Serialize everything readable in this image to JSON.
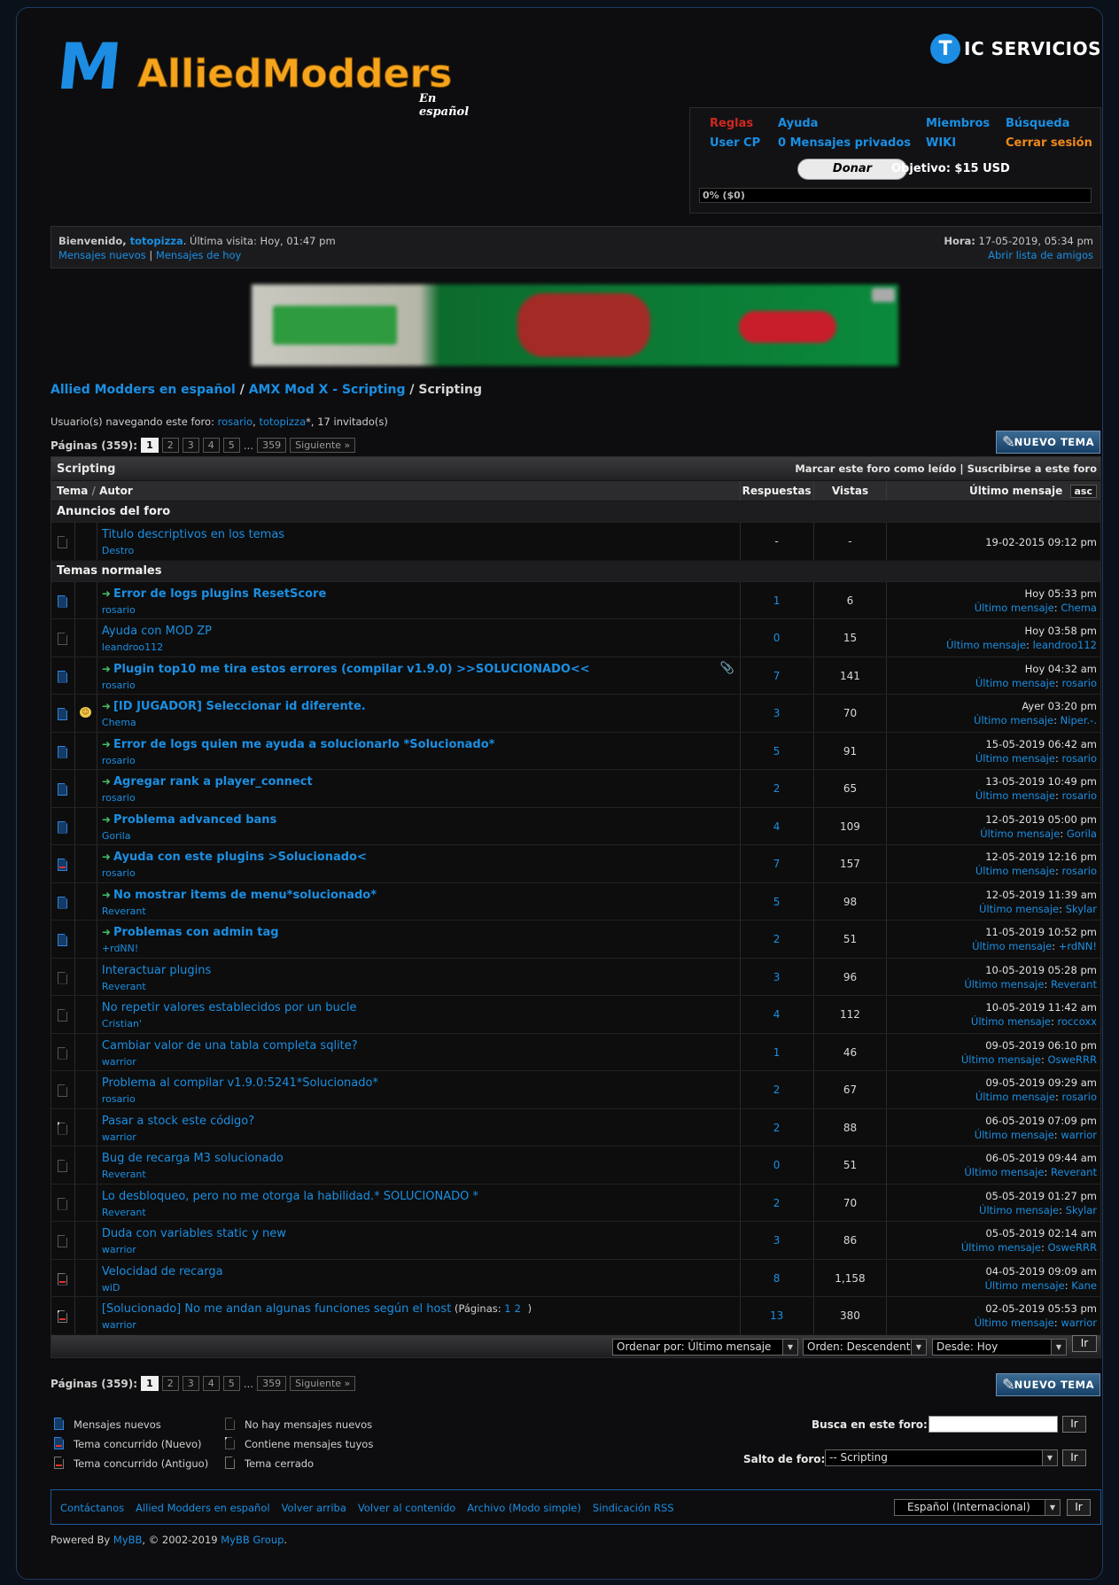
{
  "header": {
    "logo_mark": "M",
    "logo_word": "AlliedModders",
    "logo_sub": "En español",
    "tic_letter": "T",
    "tic_text": "IC SERVICIOS"
  },
  "userbox": {
    "links_row1": [
      "Reglas",
      "Ayuda",
      "Miembros",
      "Búsqueda"
    ],
    "links_row2": [
      "User CP",
      "0 Mensajes privados",
      "WIKI",
      "Cerrar sesión"
    ],
    "donate_label": "Donar",
    "goal_text": "Objetivo: $15 USD",
    "progress_text": "0% ($0)",
    "progress_fraction": 0,
    "colors": {
      "reglas": "#d0281e",
      "cerrar": "#f08a1a",
      "link": "#1a8fe3"
    }
  },
  "welcome": {
    "greeting_pre": "Bienvenido, ",
    "username": "totopizza",
    "last_visit": ". Última visita: Hoy, 01:47 pm",
    "new_posts": "Mensajes nuevos",
    "sep": "|",
    "today_posts": "Mensajes de hoy",
    "time_label": "Hora:",
    "time_value": " 17-05-2019, 05:34 pm",
    "buddy_list": "Abrir lista de amigos"
  },
  "breadcrumb": {
    "home": "Allied Modders en español",
    "sep1": " / ",
    "forum": "AMX Mod X - Scripting",
    "sep2": " / ",
    "current": "Scripting"
  },
  "browsing": {
    "label": "Usuario(s) navegando este foro: ",
    "u1": "rosario",
    "comma": ", ",
    "u2": "totopizza",
    "rest": "*, 17 invitado(s)"
  },
  "pagination": {
    "label": "Páginas (359):",
    "pages": [
      "1",
      "2",
      "3",
      "4",
      "5"
    ],
    "dots": "...",
    "last": "359",
    "next": "Siguiente »"
  },
  "new_thread_label": "NUEVO TEMA",
  "table": {
    "title": "Scripting",
    "mark_read": "Marcar este foro como leído",
    "sep": " | ",
    "subscribe": "Suscribirse a este foro",
    "col_tema": "Tema",
    "col_sep": " / ",
    "col_autor": "Autor",
    "col_replies": "Respuestas",
    "col_views": "Vistas",
    "col_last": "Último mensaje",
    "sort_dir": "asc",
    "section_announce": "Anuncios del foro",
    "section_normal": "Temas normales",
    "announcement": {
      "subject": "Titulo descriptivos en los temas",
      "author": "Destro",
      "replies": "-",
      "views": "-",
      "last": "19-02-2015 09:12 pm"
    },
    "last_post_label": "Último mensaje",
    "threads": [
      {
        "icon": "new",
        "sticky": true,
        "subject": "Error de logs plugins ResetScore",
        "author": "rosario",
        "replies": "1",
        "views": "6",
        "last_date": "Hoy 05:33 pm",
        "last_user": "Chema",
        "clip": false,
        "rowicon": false,
        "mine": false
      },
      {
        "icon": "old",
        "sticky": false,
        "subject": "Ayuda con MOD ZP",
        "author": "leandroo112",
        "replies": "0",
        "views": "15",
        "last_date": "Hoy 03:58 pm",
        "last_user": "leandroo112",
        "clip": false,
        "rowicon": false,
        "mine": false
      },
      {
        "icon": "new",
        "sticky": true,
        "subject": "Plugin top10 me tira estos errores (compilar v1.9.0) >>SOLUCIONADO<<",
        "author": "rosario",
        "replies": "7",
        "views": "141",
        "last_date": "Hoy 04:32 am",
        "last_user": "rosario",
        "clip": true,
        "rowicon": false,
        "mine": false
      },
      {
        "icon": "new",
        "sticky": true,
        "subject": "[ID JUGADOR] Seleccionar id diferente.",
        "author": "Chema",
        "replies": "3",
        "views": "70",
        "last_date": "Ayer 03:20 pm",
        "last_user": "Niper.-.",
        "clip": false,
        "rowicon": true,
        "mine": false
      },
      {
        "icon": "new",
        "sticky": true,
        "subject": "Error de logs quien me ayuda a solucionarlo *Solucionado*",
        "author": "rosario",
        "replies": "5",
        "views": "91",
        "last_date": "15-05-2019 06:42 am",
        "last_user": "rosario",
        "clip": false,
        "rowicon": false,
        "mine": false
      },
      {
        "icon": "new",
        "sticky": true,
        "subject": "Agregar rank a player_connect",
        "author": "rosario",
        "replies": "2",
        "views": "65",
        "last_date": "13-05-2019 10:49 pm",
        "last_user": "rosario",
        "clip": false,
        "rowicon": false,
        "mine": false
      },
      {
        "icon": "new",
        "sticky": true,
        "subject": "Problema advanced bans",
        "author": "Gorila",
        "replies": "4",
        "views": "109",
        "last_date": "12-05-2019 05:00 pm",
        "last_user": "Gorila",
        "clip": false,
        "rowicon": false,
        "mine": false
      },
      {
        "icon": "hot",
        "sticky": true,
        "subject": "Ayuda con este plugins >Solucionado<",
        "author": "rosario",
        "replies": "7",
        "views": "157",
        "last_date": "12-05-2019 12:16 pm",
        "last_user": "rosario",
        "clip": false,
        "rowicon": false,
        "mine": false
      },
      {
        "icon": "new",
        "sticky": true,
        "subject": "No mostrar items de menu*solucionado*",
        "author": "Reverant",
        "replies": "5",
        "views": "98",
        "last_date": "12-05-2019 11:39 am",
        "last_user": "Skylar",
        "clip": false,
        "rowicon": false,
        "mine": false
      },
      {
        "icon": "new",
        "sticky": true,
        "subject": "Problemas con admin tag",
        "author": "+rdNN!",
        "replies": "2",
        "views": "51",
        "last_date": "11-05-2019 10:52 pm",
        "last_user": "+rdNN!",
        "clip": false,
        "rowicon": false,
        "mine": false
      },
      {
        "icon": "old",
        "sticky": false,
        "subject": "Interactuar plugins",
        "author": "Reverant",
        "replies": "3",
        "views": "96",
        "last_date": "10-05-2019 05:28 pm",
        "last_user": "Reverant",
        "clip": false,
        "rowicon": false,
        "mine": false
      },
      {
        "icon": "old",
        "sticky": false,
        "subject": "No repetir valores establecidos por un bucle",
        "author": "Cristian'",
        "replies": "4",
        "views": "112",
        "last_date": "10-05-2019 11:42 am",
        "last_user": "roccoxx",
        "clip": false,
        "rowicon": false,
        "mine": false
      },
      {
        "icon": "old",
        "sticky": false,
        "subject": "Cambiar valor de una tabla completa sqlite?",
        "author": "warrior",
        "replies": "1",
        "views": "46",
        "last_date": "09-05-2019 06:10 pm",
        "last_user": "OsweRRR",
        "clip": false,
        "rowicon": false,
        "mine": false
      },
      {
        "icon": "old",
        "sticky": false,
        "subject": "Problema al compilar v1.9.0:5241*Solucionado*",
        "author": "rosario",
        "replies": "2",
        "views": "67",
        "last_date": "09-05-2019 09:29 am",
        "last_user": "rosario",
        "clip": false,
        "rowicon": false,
        "mine": false
      },
      {
        "icon": "old",
        "sticky": false,
        "subject": "Pasar a stock este código?",
        "author": "warrior",
        "replies": "2",
        "views": "88",
        "last_date": "06-05-2019 07:09 pm",
        "last_user": "warrior",
        "clip": false,
        "rowicon": false,
        "mine": true
      },
      {
        "icon": "old",
        "sticky": false,
        "subject": "Bug de recarga M3 solucionado",
        "author": "Reverant",
        "replies": "0",
        "views": "51",
        "last_date": "06-05-2019 09:44 am",
        "last_user": "Reverant",
        "clip": false,
        "rowicon": false,
        "mine": false
      },
      {
        "icon": "old",
        "sticky": false,
        "subject": "Lo desbloqueo, pero no me otorga la habilidad.* SOLUCIONADO *",
        "author": "Reverant",
        "replies": "2",
        "views": "70",
        "last_date": "05-05-2019 01:27 pm",
        "last_user": "Skylar",
        "clip": false,
        "rowicon": false,
        "mine": false
      },
      {
        "icon": "old",
        "sticky": false,
        "subject": "Duda con variables static y new",
        "author": "warrior",
        "replies": "3",
        "views": "86",
        "last_date": "05-05-2019 02:14 am",
        "last_user": "OsweRRR",
        "clip": false,
        "rowicon": false,
        "mine": false
      },
      {
        "icon": "hotold",
        "sticky": false,
        "subject": "Velocidad de recarga",
        "author": "wiD",
        "replies": "8",
        "views": "1,158",
        "last_date": "04-05-2019 09:09 am",
        "last_user": "Kane",
        "clip": false,
        "rowicon": false,
        "mine": false
      },
      {
        "icon": "hotold",
        "sticky": false,
        "subject": "[Solucionado] No me andan algunas funciones según el host",
        "author": "warrior",
        "replies": "13",
        "views": "380",
        "last_date": "02-05-2019 05:53 pm",
        "last_user": "warrior",
        "clip": false,
        "rowicon": false,
        "mine": true,
        "subpages_label": " (Páginas: ",
        "subpages": [
          "1",
          "2"
        ],
        "subpages_end": " )"
      }
    ]
  },
  "sort_bar": {
    "order_by": "Ordenar por: Último mensaje",
    "order": "Orden: Descendente",
    "since": "Desde: Hoy",
    "go": "Ir"
  },
  "legend": {
    "new": "Mensajes nuevos",
    "hot_new": "Tema concurrido (Nuevo)",
    "hot_old": "Tema concurrido (Antiguo)",
    "no_new": "No hay mensajes nuevos",
    "mine": "Contiene mensajes tuyos",
    "locked": "Tema cerrado"
  },
  "search": {
    "label": "Busca en este foro:",
    "value": "",
    "go": "Ir"
  },
  "jump": {
    "label": "Salto de foro:",
    "selected": "-- Scripting",
    "go": "Ir"
  },
  "footer": {
    "links": [
      "Contáctanos",
      "Allied Modders en español",
      "Volver arriba",
      "Volver al contenido",
      "Archivo (Modo simple)",
      "Sindicación RSS"
    ],
    "language": "Español (Internacional)",
    "go": "Ir",
    "powered_pre": "Powered By ",
    "mybb": "MyBB",
    "powered_mid": ", © 2002-2019 ",
    "mybb_group": "MyBB Group",
    "powered_end": "."
  }
}
